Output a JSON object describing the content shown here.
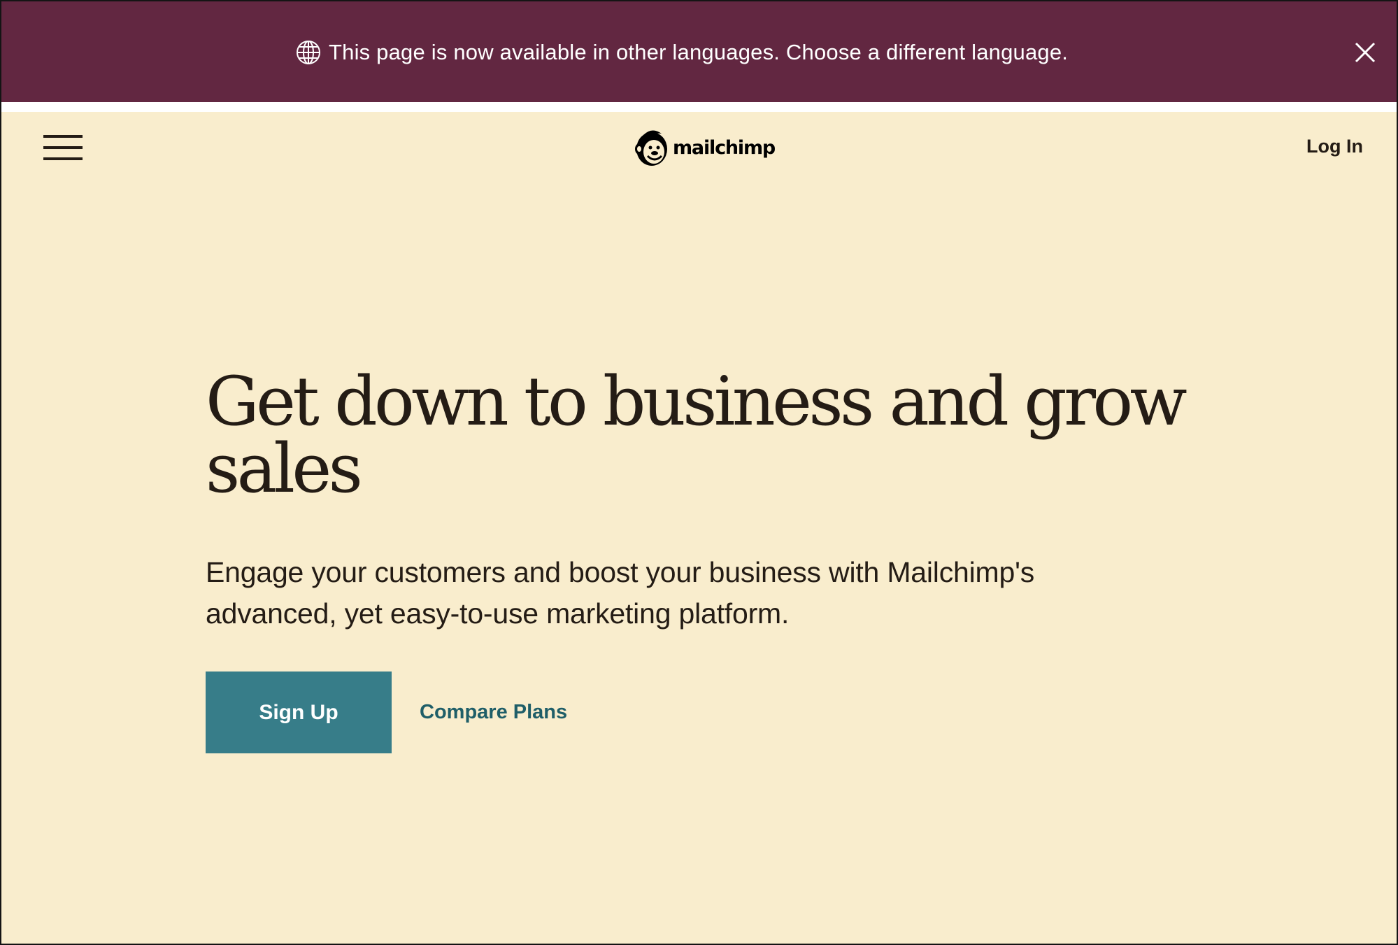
{
  "banner": {
    "icon": "globe-icon",
    "message": "This page is now available in other languages. Choose a different language.",
    "close_icon": "close-icon",
    "background_color": "#622741"
  },
  "nav": {
    "menu_icon": "hamburger-icon",
    "logo_text": "mailchimp",
    "login_label": "Log In"
  },
  "hero": {
    "title": "Get down to business and grow sales",
    "subtitle": "Engage your customers and boost your business with Mailchimp's advanced, yet easy-to-use marketing platform.",
    "primary_cta": "Sign Up",
    "secondary_cta": "Compare Plans",
    "primary_color": "#377d89",
    "background_color": "#f9edcd"
  }
}
